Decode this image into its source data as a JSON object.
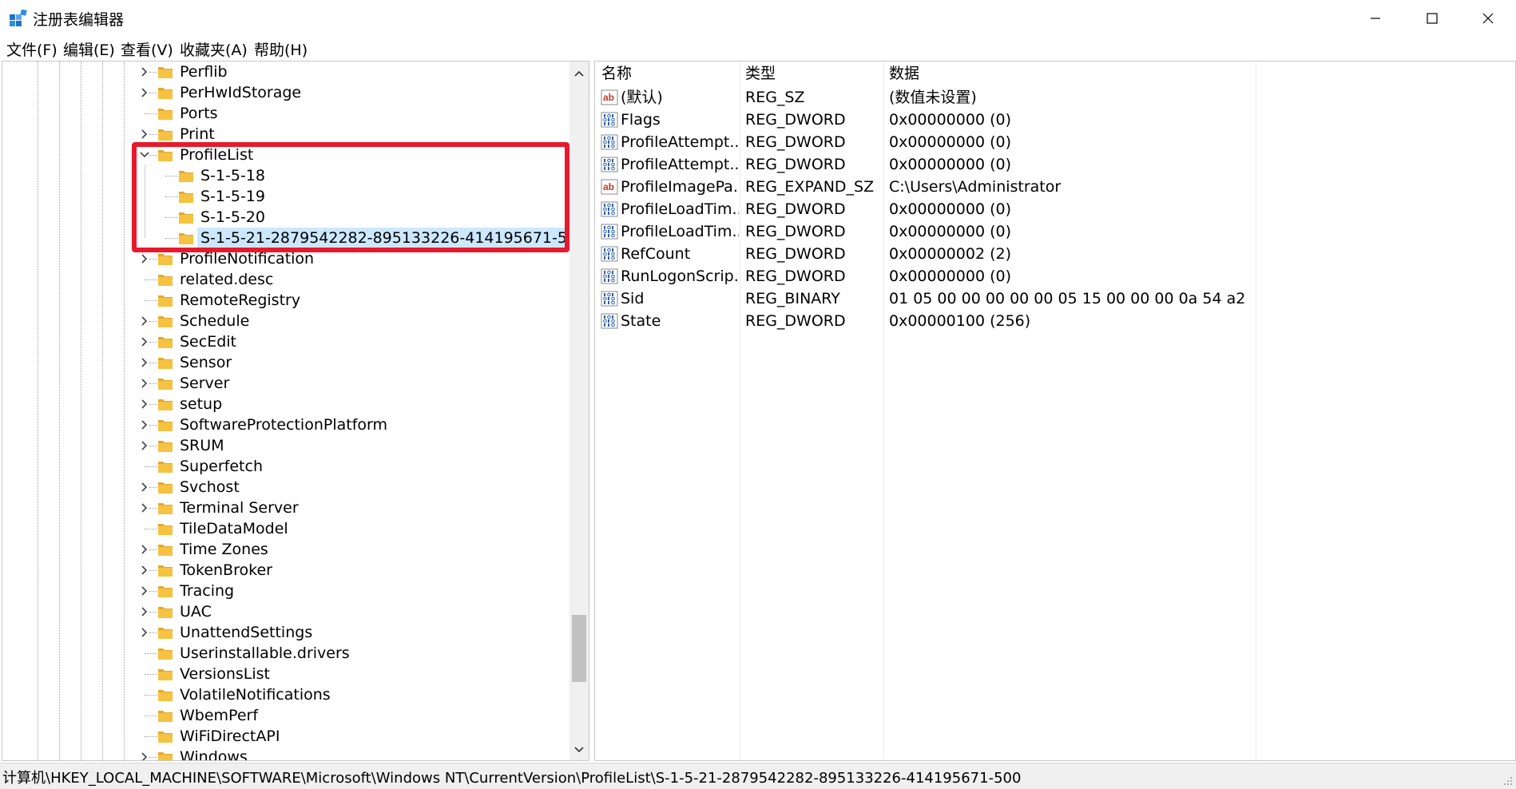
{
  "window": {
    "title": "注册表编辑器",
    "minimize_glyph": "—",
    "maximize_glyph": "☐",
    "close_glyph": "✕"
  },
  "menu": [
    {
      "label": "文件(F)"
    },
    {
      "label": "编辑(E)"
    },
    {
      "label": "查看(V)"
    },
    {
      "label": "收藏夹(A)"
    },
    {
      "label": "帮助(H)"
    }
  ],
  "tree": {
    "items": [
      {
        "label": "Perflib",
        "level": 0,
        "expander": "collapsed"
      },
      {
        "label": "PerHwIdStorage",
        "level": 0,
        "expander": "collapsed"
      },
      {
        "label": "Ports",
        "level": 0,
        "expander": "none"
      },
      {
        "label": "Print",
        "level": 0,
        "expander": "collapsed"
      },
      {
        "label": "ProfileList",
        "level": 0,
        "expander": "expanded"
      },
      {
        "label": "S-1-5-18",
        "level": 1,
        "expander": "none"
      },
      {
        "label": "S-1-5-19",
        "level": 1,
        "expander": "none"
      },
      {
        "label": "S-1-5-20",
        "level": 1,
        "expander": "none"
      },
      {
        "label": "S-1-5-21-2879542282-895133226-414195671-500",
        "level": 1,
        "expander": "none",
        "selected": true
      },
      {
        "label": "ProfileNotification",
        "level": 0,
        "expander": "collapsed"
      },
      {
        "label": "related.desc",
        "level": 0,
        "expander": "none"
      },
      {
        "label": "RemoteRegistry",
        "level": 0,
        "expander": "none"
      },
      {
        "label": "Schedule",
        "level": 0,
        "expander": "collapsed"
      },
      {
        "label": "SecEdit",
        "level": 0,
        "expander": "collapsed"
      },
      {
        "label": "Sensor",
        "level": 0,
        "expander": "collapsed"
      },
      {
        "label": "Server",
        "level": 0,
        "expander": "collapsed"
      },
      {
        "label": "setup",
        "level": 0,
        "expander": "collapsed"
      },
      {
        "label": "SoftwareProtectionPlatform",
        "level": 0,
        "expander": "collapsed"
      },
      {
        "label": "SRUM",
        "level": 0,
        "expander": "collapsed"
      },
      {
        "label": "Superfetch",
        "level": 0,
        "expander": "none"
      },
      {
        "label": "Svchost",
        "level": 0,
        "expander": "collapsed"
      },
      {
        "label": "Terminal Server",
        "level": 0,
        "expander": "collapsed"
      },
      {
        "label": "TileDataModel",
        "level": 0,
        "expander": "none"
      },
      {
        "label": "Time Zones",
        "level": 0,
        "expander": "collapsed"
      },
      {
        "label": "TokenBroker",
        "level": 0,
        "expander": "collapsed"
      },
      {
        "label": "Tracing",
        "level": 0,
        "expander": "collapsed"
      },
      {
        "label": "UAC",
        "level": 0,
        "expander": "collapsed"
      },
      {
        "label": "UnattendSettings",
        "level": 0,
        "expander": "collapsed"
      },
      {
        "label": "Userinstallable.drivers",
        "level": 0,
        "expander": "none"
      },
      {
        "label": "VersionsList",
        "level": 0,
        "expander": "none"
      },
      {
        "label": "VolatileNotifications",
        "level": 0,
        "expander": "none"
      },
      {
        "label": "WbemPerf",
        "level": 0,
        "expander": "none"
      },
      {
        "label": "WiFiDirectAPI",
        "level": 0,
        "expander": "none"
      },
      {
        "label": "Windows",
        "level": 0,
        "expander": "collapsed"
      }
    ]
  },
  "values": {
    "columns": [
      "名称",
      "类型",
      "数据"
    ],
    "rows": [
      {
        "icon": "string-value-icon",
        "name": "(默认)",
        "type": "REG_SZ",
        "data": "(数值未设置)"
      },
      {
        "icon": "binary-value-icon",
        "name": "Flags",
        "type": "REG_DWORD",
        "data": "0x00000000 (0)"
      },
      {
        "icon": "binary-value-icon",
        "name": "ProfileAttempt...",
        "type": "REG_DWORD",
        "data": "0x00000000 (0)"
      },
      {
        "icon": "binary-value-icon",
        "name": "ProfileAttempt...",
        "type": "REG_DWORD",
        "data": "0x00000000 (0)"
      },
      {
        "icon": "string-value-icon",
        "name": "ProfileImagePa...",
        "type": "REG_EXPAND_SZ",
        "data": "C:\\Users\\Administrator"
      },
      {
        "icon": "binary-value-icon",
        "name": "ProfileLoadTim...",
        "type": "REG_DWORD",
        "data": "0x00000000 (0)"
      },
      {
        "icon": "binary-value-icon",
        "name": "ProfileLoadTim...",
        "type": "REG_DWORD",
        "data": "0x00000000 (0)"
      },
      {
        "icon": "binary-value-icon",
        "name": "RefCount",
        "type": "REG_DWORD",
        "data": "0x00000002 (2)"
      },
      {
        "icon": "binary-value-icon",
        "name": "RunLogonScrip...",
        "type": "REG_DWORD",
        "data": "0x00000000 (0)"
      },
      {
        "icon": "binary-value-icon",
        "name": "Sid",
        "type": "REG_BINARY",
        "data": "01 05 00 00 00 00 00 05 15 00 00 00 0a 54 a2 ..."
      },
      {
        "icon": "binary-value-icon",
        "name": "State",
        "type": "REG_DWORD",
        "data": "0x00000100 (256)"
      }
    ]
  },
  "status": {
    "path": "计算机\\HKEY_LOCAL_MACHINE\\SOFTWARE\\Microsoft\\Windows NT\\CurrentVersion\\ProfileList\\S-1-5-21-2879542282-895133226-414195671-500"
  },
  "colors": {
    "selection": "#cce8ff",
    "highlight_box": "#e8192c",
    "folder": "#f5c242",
    "string_icon": "#c0392b",
    "binary_icon": "#2a5fa8"
  }
}
